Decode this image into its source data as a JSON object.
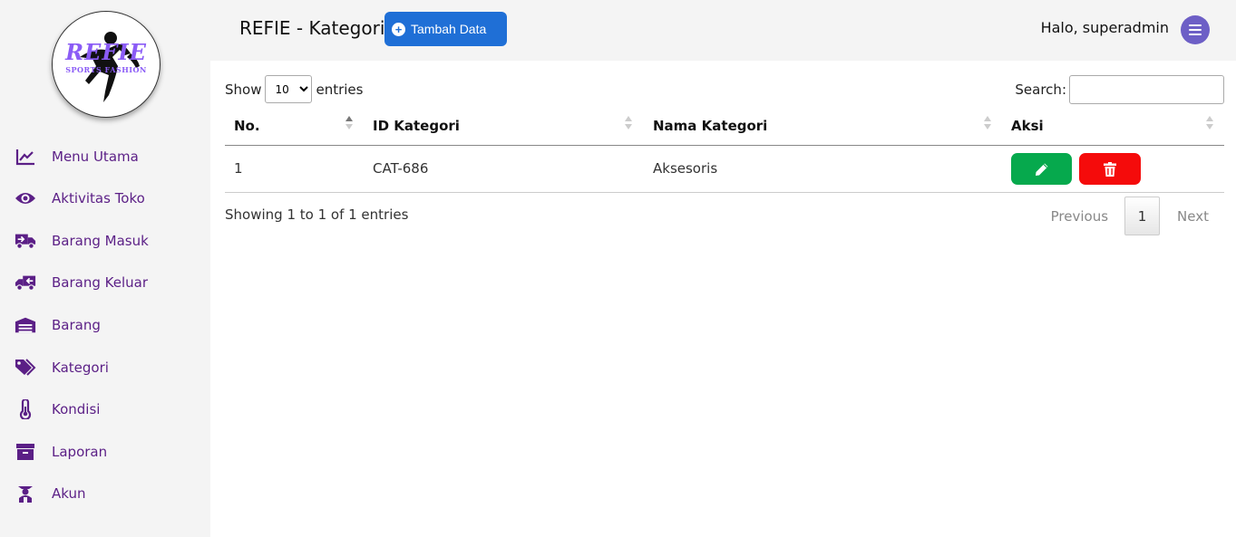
{
  "logo": {
    "title": "REFIE",
    "subtitle": "SPORTS FASHION"
  },
  "sidebar": {
    "items": [
      {
        "label": "Menu Utama",
        "icon": "chart-line-icon"
      },
      {
        "label": "Aktivitas Toko",
        "icon": "eye-icon"
      },
      {
        "label": "Barang Masuk",
        "icon": "truck-in-icon"
      },
      {
        "label": "Barang Keluar",
        "icon": "truck-out-icon"
      },
      {
        "label": "Barang",
        "icon": "warehouse-icon"
      },
      {
        "label": "Kategori",
        "icon": "tags-icon"
      },
      {
        "label": "Kondisi",
        "icon": "thermometer-icon"
      },
      {
        "label": "Laporan",
        "icon": "archive-icon"
      },
      {
        "label": "Akun",
        "icon": "user-group-icon"
      }
    ]
  },
  "header": {
    "title": "REFIE - Kategori",
    "add_button": "Tambah Data",
    "greeting": "Halo, superadmin"
  },
  "table": {
    "show_label": "Show",
    "page_length": "10",
    "length_options": [
      "10"
    ],
    "entries_label": "entries",
    "search_label": "Search:",
    "search_value": "",
    "columns": [
      "No.",
      "ID Kategori",
      "Nama Kategori",
      "Aksi"
    ],
    "rows": [
      {
        "no": "1",
        "id": "CAT-686",
        "name": "Aksesoris"
      }
    ],
    "info": "Showing 1 to 1 of 1 entries",
    "pager": {
      "previous": "Previous",
      "page": "1",
      "next": "Next"
    }
  },
  "colors": {
    "sidebar_text": "#5b1f86",
    "add_button": "#1f6fd6",
    "edit_button": "#06a94d",
    "delete_button": "#f50b0b",
    "menu_button": "#6d5fc6",
    "logo_accent": "#8b5cf6"
  }
}
